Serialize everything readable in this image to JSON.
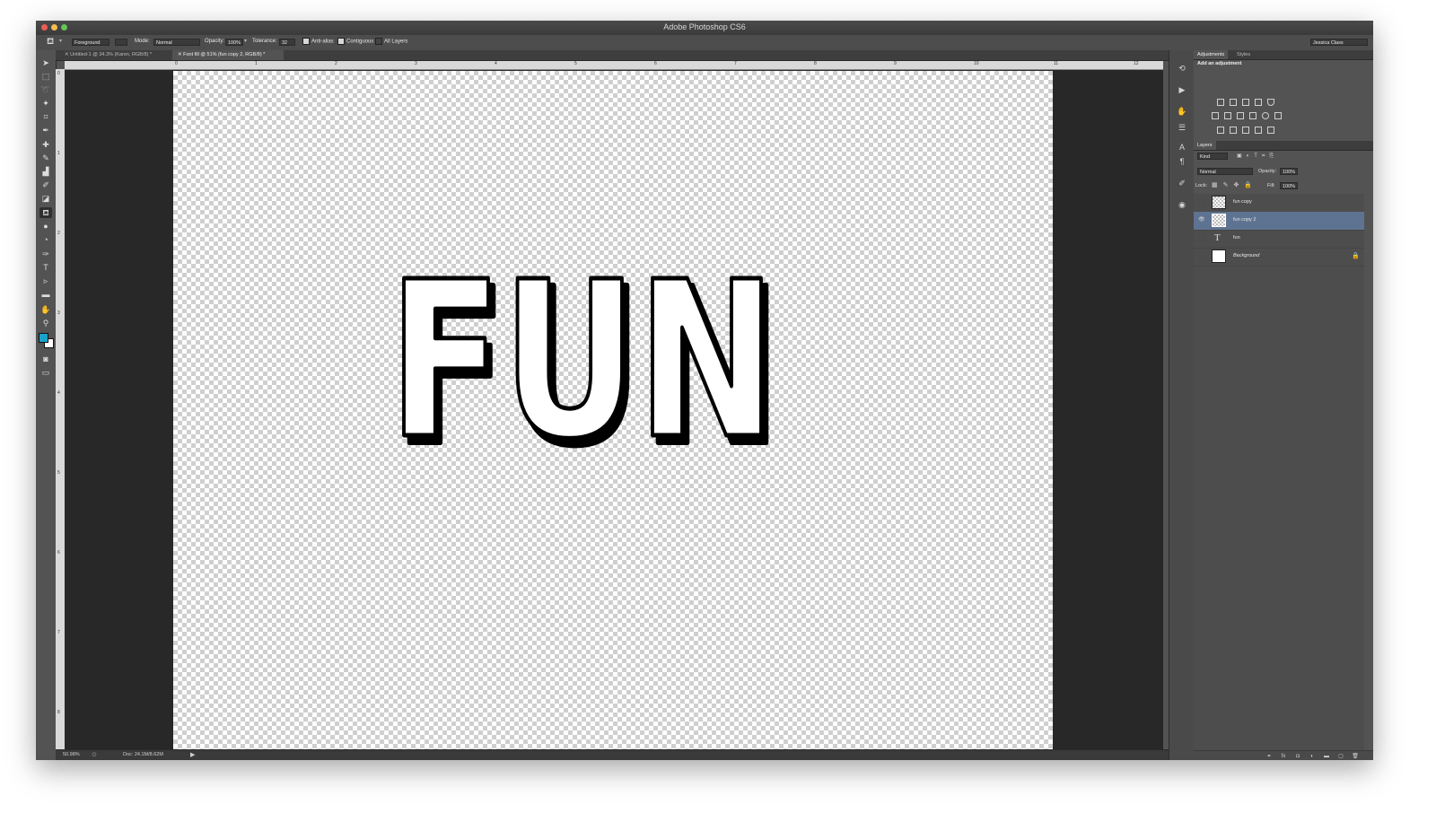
{
  "window": {
    "title": "Adobe Photoshop CS6"
  },
  "options": {
    "preset_value": "Foreground",
    "mode_label": "Mode:",
    "mode_value": "Normal",
    "opacity_label": "Opacity:",
    "opacity_value": "100%",
    "tolerance_label": "Tolerance:",
    "tolerance_value": "32",
    "antialias_label": "Anti-alias",
    "contiguous_label": "Contiguous",
    "alllayers_label": "All Layers",
    "workspace_value": "Jessica Class"
  },
  "tabs": [
    {
      "label": "Untitled-1 @ 34.3% (Karen, RGB/8) *"
    },
    {
      "label": "Font fill @ 51% (fun copy 2, RGB/8) *"
    }
  ],
  "ruler_h": [
    "0",
    "1",
    "2",
    "3",
    "4",
    "5",
    "6",
    "7",
    "8",
    "9",
    "10",
    "11",
    "12"
  ],
  "ruler_v": [
    "0",
    "1",
    "2",
    "3",
    "4",
    "5",
    "6",
    "7",
    "8"
  ],
  "artwork": {
    "text": "FUN"
  },
  "status": {
    "zoom": "50.98%",
    "doc": "Doc: 24.1M/8.62M"
  },
  "adjustments": {
    "tab_adjustments": "Adjustments",
    "tab_styles": "Styles",
    "heading": "Add an adjustment"
  },
  "layers_panel": {
    "tab": "Layers",
    "filter_value": "Kind",
    "blend_value": "Normal",
    "opacity_label": "Opacity:",
    "opacity_value": "100%",
    "lock_label": "Lock:",
    "fill_label": "Fill:",
    "fill_value": "100%",
    "layers": [
      {
        "name": "fun copy"
      },
      {
        "name": "fun copy 2"
      },
      {
        "name": "fun"
      },
      {
        "name": "Background"
      }
    ]
  },
  "colors": {
    "foreground": "#1aa3c8",
    "background": "#ffffff",
    "selection": "#5e7391"
  }
}
